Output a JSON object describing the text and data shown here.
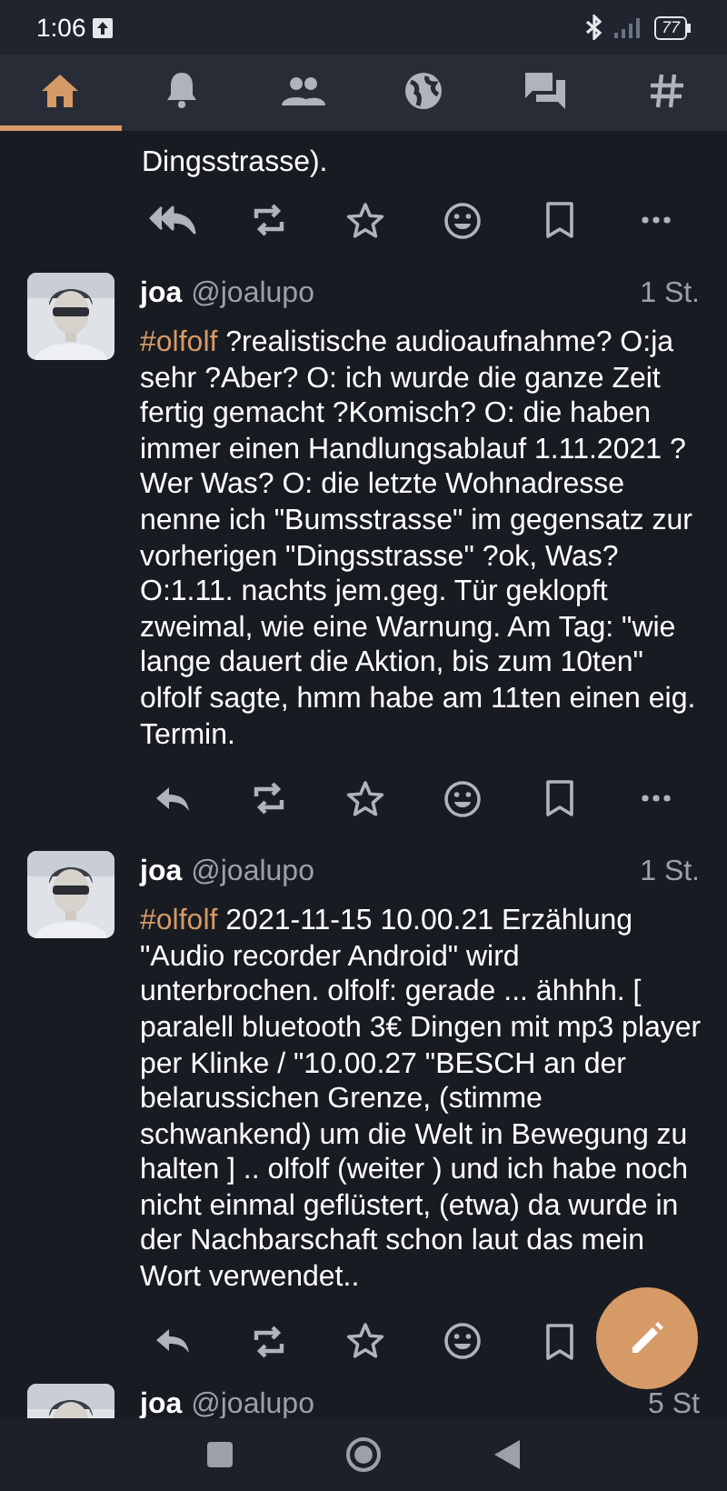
{
  "status_bar": {
    "time": "1:06",
    "battery": "77"
  },
  "tabs": [
    {
      "kind": "home",
      "selected": true
    },
    {
      "kind": "bell",
      "selected": false
    },
    {
      "kind": "people",
      "selected": false
    },
    {
      "kind": "globe",
      "selected": false
    },
    {
      "kind": "chat",
      "selected": false
    },
    {
      "kind": "hashtag",
      "selected": false
    }
  ],
  "posts": [
    {
      "kind": "partial_top",
      "text": "Dingsstrasse).",
      "actions": [
        {
          "kind": "reply_all"
        },
        {
          "kind": "boost"
        },
        {
          "kind": "star"
        },
        {
          "kind": "emoji"
        },
        {
          "kind": "bookmark"
        },
        {
          "kind": "more"
        }
      ]
    },
    {
      "kind": "full",
      "name": "joa",
      "handle": "@joalupo",
      "time": "1 St.",
      "hashtag": "#olfolf",
      "text": "?realistische audioaufnahme? O:ja sehr ?Aber? O: ich wurde die ganze Zeit fertig gemacht ?Komisch? O: die haben immer einen Handlungsablauf 1.11.2021 ? Wer Was? O: die letzte Wohnadresse nenne ich \"Bumsstrasse\" im gegensatz zur vorherigen \"Dingsstrasse\" ?ok, Was? O:1.11. nachts jem.geg. Tür geklopft zweimal, wie eine Warnung. Am Tag: \"wie lange dauert die Aktion, bis zum 10ten\" olfolf sagte, hmm habe am 11ten einen eig. Termin.",
      "actions": [
        {
          "kind": "reply"
        },
        {
          "kind": "boost"
        },
        {
          "kind": "star"
        },
        {
          "kind": "emoji"
        },
        {
          "kind": "bookmark"
        },
        {
          "kind": "more"
        }
      ]
    },
    {
      "kind": "full",
      "name": "joa",
      "handle": "@joalupo",
      "time": "1 St.",
      "hashtag": "#olfolf",
      "text": "2021-11-15 10.00.21 Erzählung \"Audio recorder Android\" wird unterbrochen. olfolf: gerade ... ähhhh. [ paralell bluetooth 3€ Dingen mit mp3 player per Klinke / \"10.00.27 \"BESCH an der belarussichen Grenze, (stimme schwankend) um die Welt in Bewegung zu halten ] .. olfolf (weiter ) und ich habe noch nicht einmal geflüstert, (etwa) da wurde in der Nachbarschaft schon laut das mein Wort verwendet..",
      "actions": [
        {
          "kind": "reply"
        },
        {
          "kind": "boost"
        },
        {
          "kind": "star"
        },
        {
          "kind": "emoji"
        },
        {
          "kind": "bookmark"
        }
      ]
    },
    {
      "kind": "partial_bottom",
      "name": "joa",
      "handle": "@joalupo",
      "time": "5 St"
    }
  ]
}
